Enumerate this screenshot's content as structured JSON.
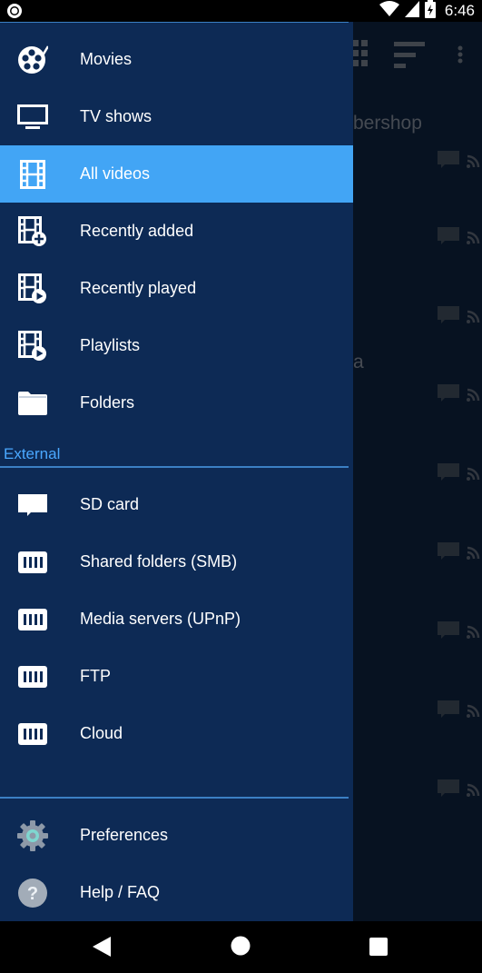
{
  "status_bar": {
    "time": "6:46"
  },
  "background": {
    "partial_texts": [
      "bershop",
      "a"
    ]
  },
  "drawer": {
    "items": [
      {
        "label": "Movies",
        "icon": "film-reel-icon"
      },
      {
        "label": "TV shows",
        "icon": "tv-icon"
      },
      {
        "label": "All videos",
        "icon": "film-strip-icon",
        "selected": true
      },
      {
        "label": "Recently added",
        "icon": "film-add-icon"
      },
      {
        "label": "Recently played",
        "icon": "film-play-icon"
      },
      {
        "label": "Playlists",
        "icon": "playlist-icon"
      },
      {
        "label": "Folders",
        "icon": "folder-icon"
      }
    ],
    "external_title": "External",
    "external_items": [
      {
        "label": "SD card",
        "icon": "sd-card-icon"
      },
      {
        "label": "Shared folders (SMB)",
        "icon": "network-drive-icon"
      },
      {
        "label": "Media servers (UPnP)",
        "icon": "network-drive-icon"
      },
      {
        "label": "FTP",
        "icon": "network-drive-icon"
      },
      {
        "label": "Cloud",
        "icon": "network-drive-icon"
      }
    ],
    "bottom_items": [
      {
        "label": "Preferences",
        "icon": "gear-icon"
      },
      {
        "label": "Help / FAQ",
        "icon": "help-icon"
      }
    ]
  },
  "colors": {
    "drawer_bg": "#0d2a55",
    "selected_bg": "#42a5f5",
    "accent": "#4aa8ff"
  }
}
